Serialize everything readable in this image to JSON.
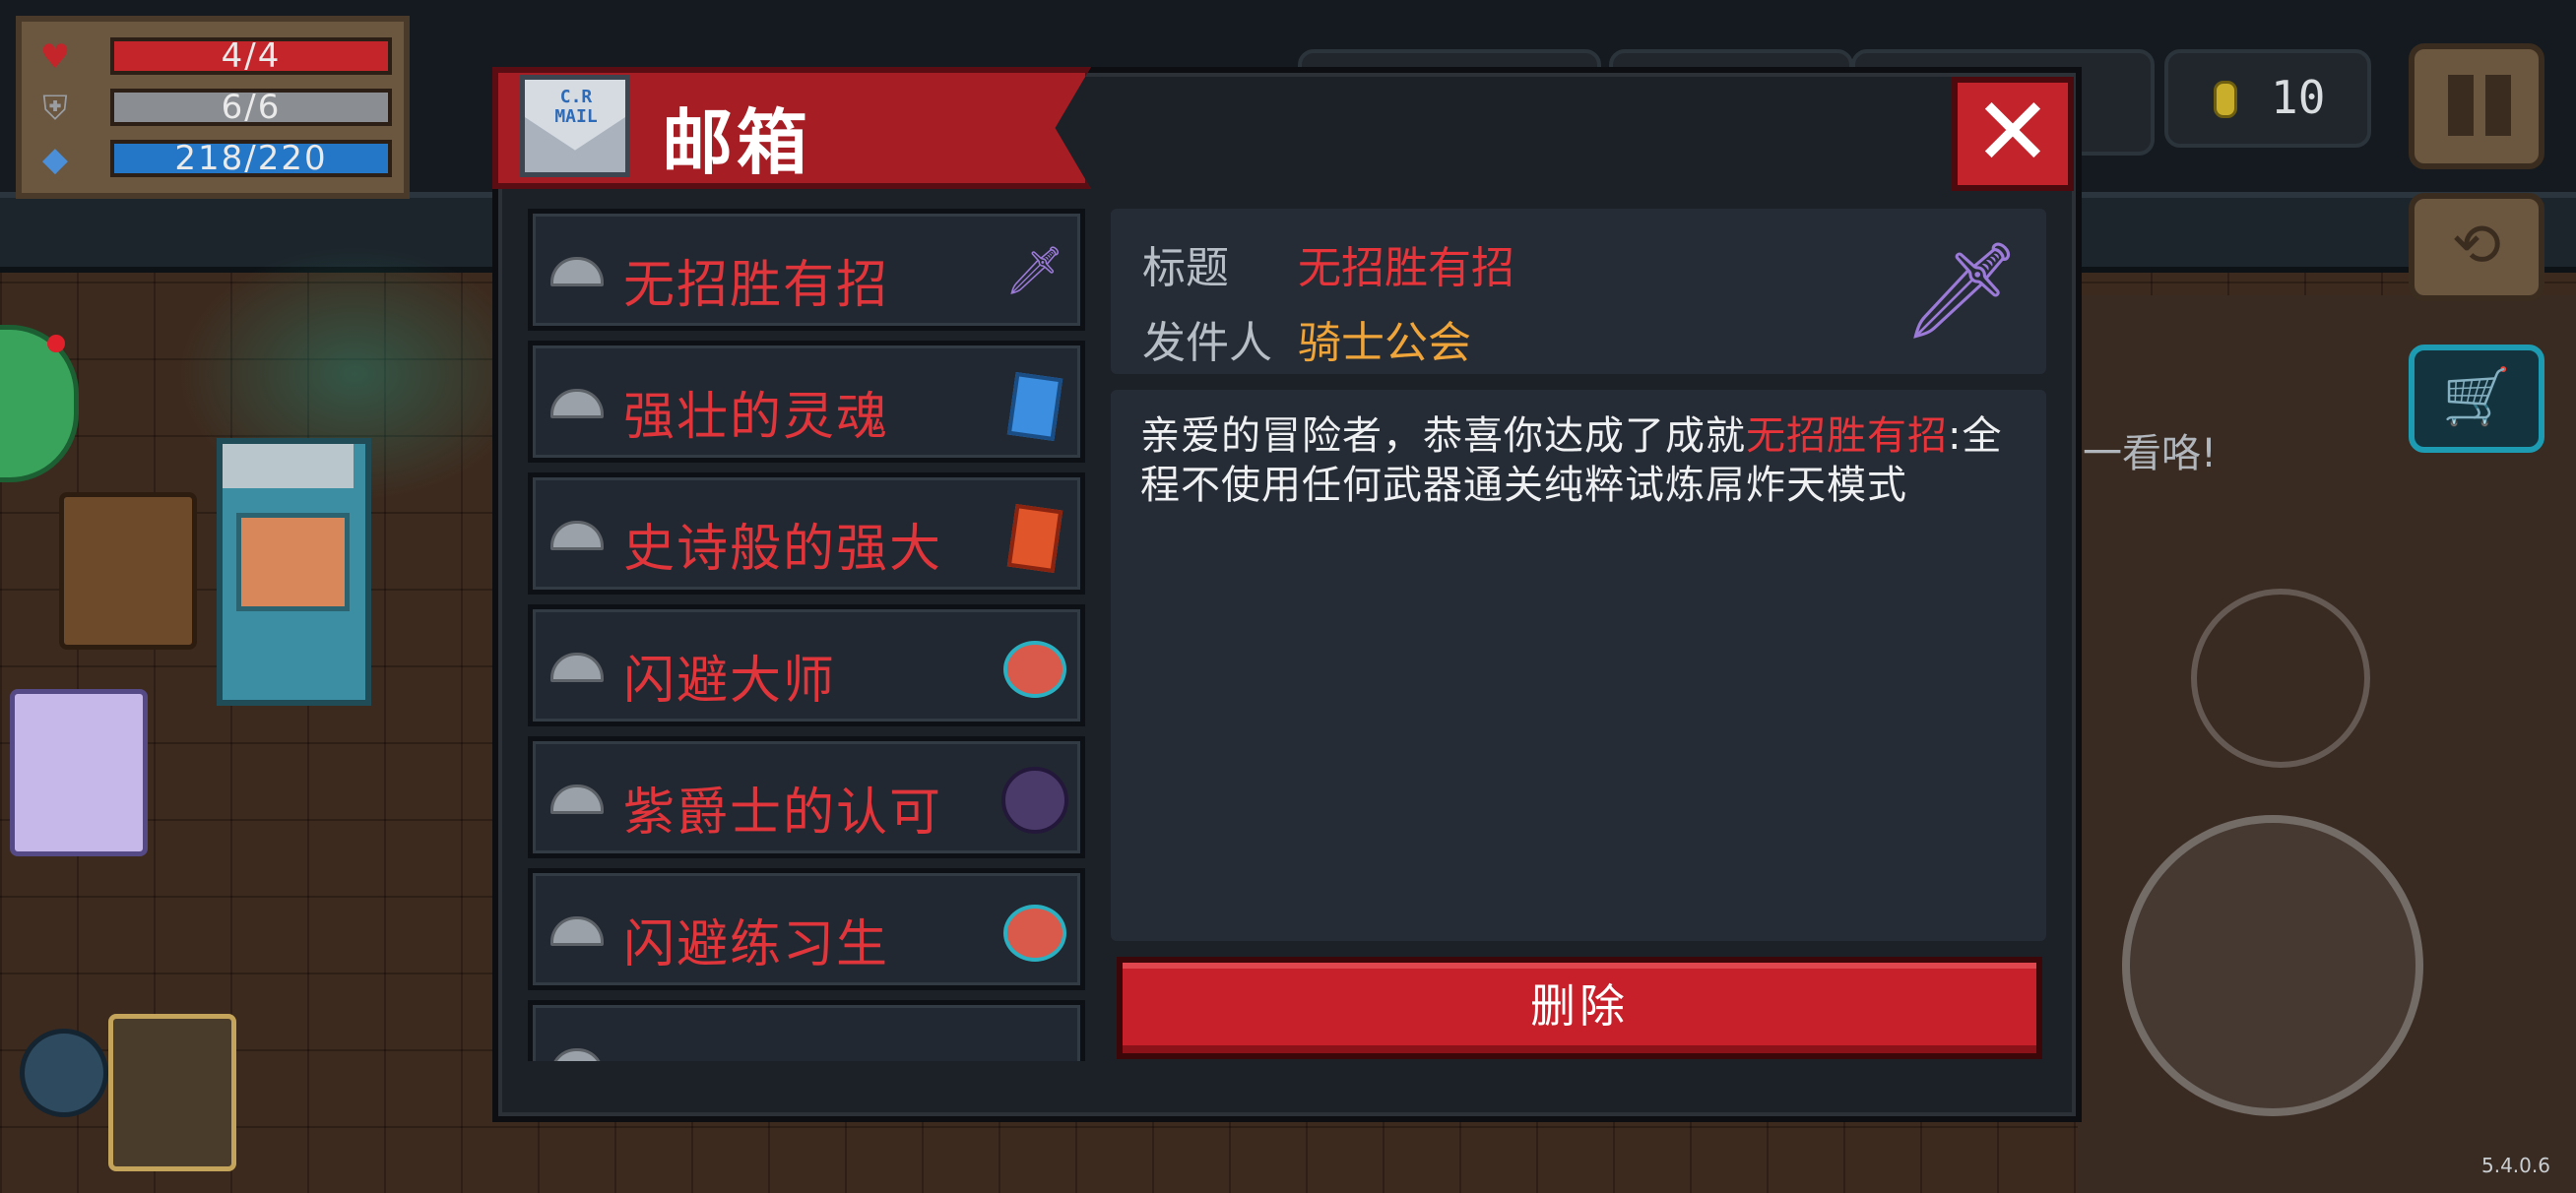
{
  "hud": {
    "health": "4/4",
    "armor": "6/6",
    "energy": "218/220",
    "coins": "10",
    "hint_text": "一看咯!",
    "version": "5.4.0.6"
  },
  "mailbox": {
    "title": "邮箱",
    "mail_stamp": "C.R\nMAIL",
    "close_symbol": "✕",
    "items": [
      {
        "label": "无招胜有招",
        "thumb_icon": "sword-hand-icon"
      },
      {
        "label": "强壮的灵魂",
        "thumb_icon": "blue-card-icon"
      },
      {
        "label": "史诗般的强大",
        "thumb_icon": "red-card-icon"
      },
      {
        "label": "闪避大师",
        "thumb_icon": "dodge-hero-icon"
      },
      {
        "label": "紫爵士的认可",
        "thumb_icon": "purple-knight-icon"
      },
      {
        "label": "闪避练习生",
        "thumb_icon": "dodge-hero-icon"
      },
      {
        "label": "",
        "thumb_icon": "partial-item-icon"
      }
    ],
    "detail": {
      "title_label": "标题",
      "title_value": "无招胜有招",
      "sender_label": "发件人",
      "sender_value": "骑士公会",
      "body_prefix": "亲爱的冒险者，恭喜你达成了成就",
      "body_highlight": "无招胜有招",
      "body_suffix": ":全程不使用任何武器通关纯粹试炼屌炸天模式",
      "delete_label": "删除"
    }
  },
  "colors": {
    "accent_red": "#e0353b",
    "sender_yellow": "#f0a53a",
    "panel_bg": "#1c2027",
    "header_red": "#a61d24"
  }
}
